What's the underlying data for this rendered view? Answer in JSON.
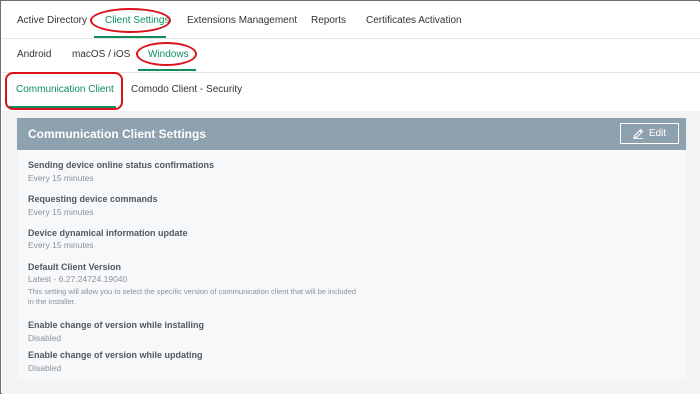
{
  "top_tabs": [
    {
      "label": "Active Directory"
    },
    {
      "label": "Client Settings"
    },
    {
      "label": "Extensions Management"
    },
    {
      "label": "Reports"
    },
    {
      "label": "Certificates Activation"
    }
  ],
  "os_tabs": [
    {
      "label": "Android"
    },
    {
      "label": "macOS / iOS"
    },
    {
      "label": "Windows"
    }
  ],
  "sub_tabs": [
    {
      "label": "Communication Client"
    },
    {
      "label": "Comodo Client - Security"
    }
  ],
  "panel": {
    "title": "Communication Client Settings",
    "edit_label": "Edit",
    "fields": [
      {
        "label": "Sending device online status confirmations",
        "value": "Every 15 minutes"
      },
      {
        "label": "Requesting device commands",
        "value": "Every 15 minutes"
      },
      {
        "label": "Device dynamical information update",
        "value": "Every 15 minutes"
      },
      {
        "label": "Default Client Version",
        "value": "Latest - 6.27.24724.19040",
        "note": "This setting will allow you to select the specific version of communication client that will be included in the installer."
      },
      {
        "label": "Enable change of version while installing",
        "value": "Disabled"
      },
      {
        "label": "Enable change of version while updating",
        "value": "Disabled"
      }
    ]
  },
  "colors": {
    "accent": "#0e8f5b",
    "highlight": "#d9121b",
    "panel_header": "#8ea1ae"
  }
}
